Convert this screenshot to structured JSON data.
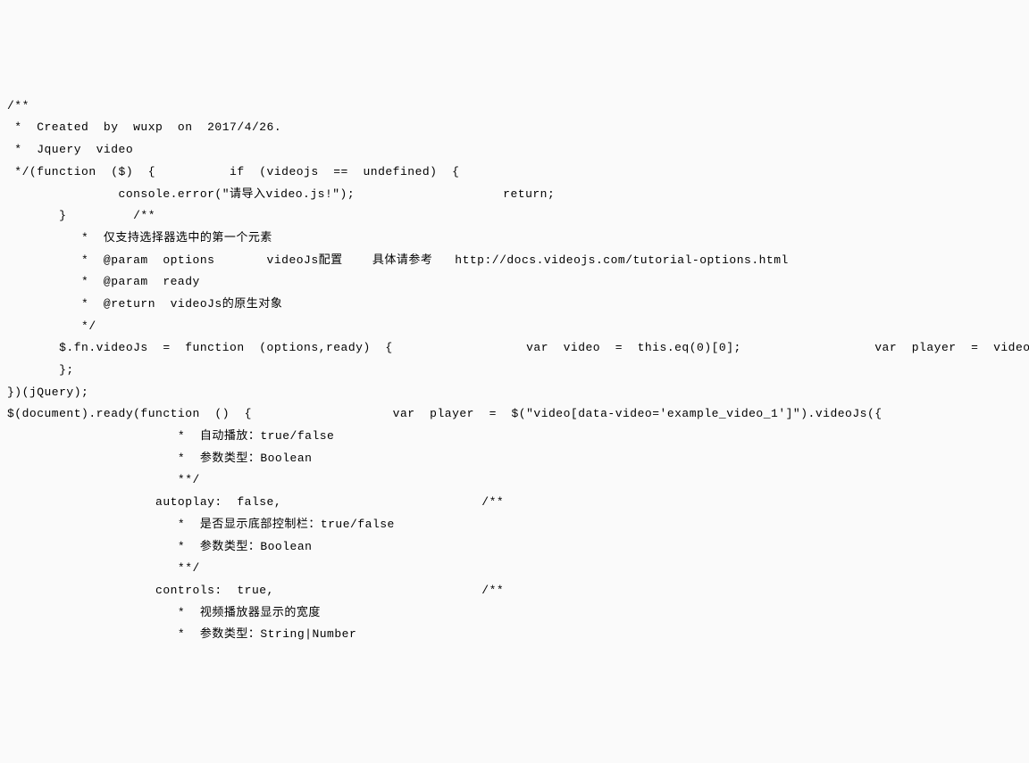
{
  "code": {
    "l01": "/**",
    "l02": " *  Created  by  wuxp  on  2017/4/26.",
    "l03": " *  Jquery  video",
    "l04": " */(function  ($)  {          if  (videojs  ==  undefined)  {",
    "l05": "               console.error(\"请导入video.js!\");                    return;",
    "l06": "       }         /**",
    "l07": "          *  仅支持选择器选中的第一个元素",
    "l08": "          *  @param  options       videoJs配置    具体请参考   http://docs.videojs.com/tutorial-options.html",
    "l09": "          *  @param  ready",
    "l10": "          *  @return  videoJs的原生对象",
    "l11": "          */",
    "l12": "       $.fn.videoJs  =  function  (options,ready)  {                  var  video  =  this.eq(0)[0];                  var  player  =  videojs(video,   options,ready);",
    "l13": "       };",
    "l14": "})(jQuery);",
    "l15": "$(document).ready(function  ()  {                   var  player  =  $(\"video[data-video='example_video_1']\").videoJs({                            /**",
    "l16": "                       *  自动播放：true/false",
    "l17": "                       *  参数类型：Boolean",
    "l18": "                       **/",
    "l19": "                    autoplay:  false,                           /**",
    "l20": "                       *  是否显示底部控制栏：true/false",
    "l21": "                       *  参数类型：Boolean",
    "l22": "                       **/",
    "l23": "                    controls:  true,                            /**",
    "l24": "                       *  视频播放器显示的宽度",
    "l25": "                       *  参数类型：String|Number"
  }
}
